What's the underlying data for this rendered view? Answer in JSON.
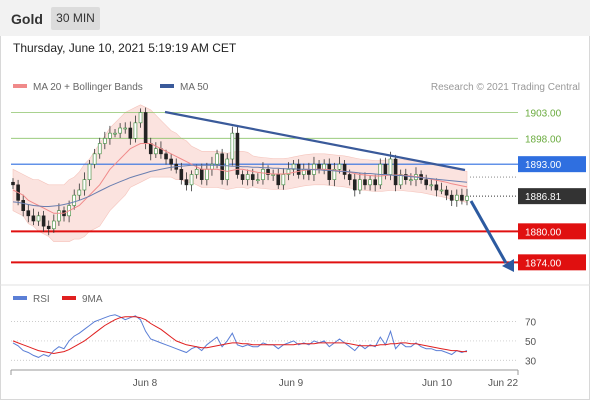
{
  "header": {
    "title": "Gold",
    "timeframe": "30 MIN"
  },
  "timestamp": "Thursday, June 10, 2021 5:19:19 AM CET",
  "legend_top": [
    {
      "label": "MA 20 + Bollinger Bands",
      "color": "#f08a8a"
    },
    {
      "label": "MA 50",
      "color": "#3a5a9a"
    }
  ],
  "credit": "Research © 2021 Trading Central",
  "legend_bottom": [
    {
      "label": "RSI",
      "color": "#5b7fd6"
    },
    {
      "label": "9MA",
      "color": "#e02020"
    }
  ],
  "colors": {
    "resistance": "#8cc36a",
    "pivot": "#2f6fe0",
    "support": "#e01010",
    "last": "#333333",
    "trendline": "#3a5a9a",
    "band": "#fbe3df"
  },
  "chart_data": [
    {
      "type": "candlestick",
      "title": "Gold",
      "x_labels": [
        "Jun 8",
        "Jun 9",
        "Jun 10",
        "Jun 22"
      ],
      "ylim": [
        1870.0,
        1906.0
      ],
      "levels": [
        {
          "label": "1903.00",
          "value": 1903.0,
          "kind": "resistance"
        },
        {
          "label": "1898.00",
          "value": 1898.0,
          "kind": "resistance"
        },
        {
          "label": "1893.00",
          "value": 1893.0,
          "kind": "pivot"
        },
        {
          "label": "1886.81",
          "value": 1886.81,
          "kind": "last"
        },
        {
          "label": "1880.00",
          "value": 1880.0,
          "kind": "support"
        },
        {
          "label": "1874.00",
          "value": 1874.0,
          "kind": "support"
        }
      ],
      "closes": [
        1889,
        1886,
        1884,
        1883,
        1882,
        1883,
        1881,
        1880.5,
        1882,
        1884,
        1883,
        1885,
        1887,
        1888,
        1890,
        1893,
        1895,
        1897,
        1898,
        1899,
        1899,
        1900,
        1900,
        1898,
        1901,
        1903,
        1897,
        1895,
        1896,
        1895,
        1894,
        1893,
        1892,
        1890,
        1889,
        1891,
        1892,
        1890,
        1892,
        1893,
        1895,
        1890,
        1894,
        1899,
        1891,
        1890,
        1891,
        1890,
        1890,
        1892,
        1891,
        1891,
        1889,
        1891,
        1892,
        1893,
        1891,
        1892,
        1891,
        1893,
        1892,
        1893,
        1890,
        1892,
        1893,
        1891,
        1890,
        1888,
        1890,
        1889,
        1890,
        1889,
        1893,
        1891,
        1894,
        1889,
        1891,
        1890,
        1890,
        1891,
        1890,
        1889,
        1889,
        1888,
        1888,
        1887,
        1886,
        1887,
        1886,
        1886.81
      ],
      "series": [
        {
          "name": "MA 20 + Bollinger Bands",
          "values": [
            1888,
            1887.5,
            1887,
            1886,
            1885.5,
            1885,
            1884.5,
            1884,
            1883.5,
            1883.5,
            1883.5,
            1884,
            1884.5,
            1885,
            1886,
            1887,
            1888,
            1889,
            1890.5,
            1892,
            1893,
            1894,
            1895,
            1896,
            1896.5,
            1897,
            1897,
            1897,
            1896.5,
            1896,
            1895.5,
            1895,
            1894.5,
            1894,
            1893.5,
            1893,
            1892.5,
            1892,
            1892,
            1892,
            1892,
            1891.8,
            1891.6,
            1891.8,
            1892,
            1892,
            1891.8,
            1891.6,
            1891.4,
            1891.3,
            1891.2,
            1891.1,
            1891.1,
            1891.1,
            1891.2,
            1891.4,
            1891.6,
            1891.8,
            1891.9,
            1892,
            1892,
            1892,
            1891.9,
            1891.8,
            1891.7,
            1891.6,
            1891.4,
            1891.2,
            1891,
            1890.9,
            1890.8,
            1890.7,
            1890.7,
            1890.8,
            1890.9,
            1890.9,
            1890.9,
            1890.8,
            1890.7,
            1890.6,
            1890.5,
            1890.3,
            1890.1,
            1889.9,
            1889.7,
            1889.5,
            1889.2,
            1889,
            1888.8,
            1888.6
          ]
        },
        {
          "name": "MA 50",
          "values": [
            1885.7,
            1885.6,
            1885.4,
            1885.2,
            1885,
            1884.9,
            1884.8,
            1884.8,
            1884.9,
            1885,
            1885.2,
            1885.4,
            1885.7,
            1886,
            1886.4,
            1886.8,
            1887.3,
            1887.8,
            1888.3,
            1888.8,
            1889.2,
            1889.6,
            1890,
            1890.4,
            1890.7,
            1891,
            1891.3,
            1891.6,
            1891.8,
            1892,
            1892.2,
            1892.4,
            1892.5,
            1892.6,
            1892.7,
            1892.8,
            1892.8,
            1892.8,
            1892.8,
            1892.8,
            1892.8,
            1892.7,
            1892.7,
            1892.6,
            1892.6,
            1892.5,
            1892.5,
            1892.4,
            1892.4,
            1892.3,
            1892.3,
            1892.2,
            1892.2,
            1892.1,
            1892.1,
            1892.1,
            1892,
            1892,
            1892,
            1891.9,
            1891.9,
            1891.8,
            1891.8,
            1891.7,
            1891.6,
            1891.6,
            1891.5,
            1891.4,
            1891.3,
            1891.2,
            1891.2,
            1891.1,
            1891,
            1891,
            1890.9,
            1890.8,
            1890.8,
            1890.7,
            1890.6,
            1890.5,
            1890.4,
            1890.3,
            1890.2,
            1890.1,
            1890,
            1889.9,
            1889.8,
            1889.7,
            1889.6,
            1889.5
          ]
        }
      ],
      "bands_width": [
        4,
        4,
        4,
        4.5,
        4.5,
        5,
        5,
        5,
        5.5,
        5.5,
        5.5,
        6,
        6,
        6.5,
        7,
        7,
        7.5,
        8,
        8,
        8,
        8,
        8,
        8,
        7.5,
        7.5,
        7.5,
        7,
        6.5,
        6,
        5.5,
        5,
        4.5,
        4.5,
        4,
        4,
        3.5,
        3.5,
        3.5,
        3.5,
        3.5,
        3.5,
        3.5,
        3.5,
        3.5,
        3.5,
        3.5,
        3.5,
        3,
        3,
        3,
        3,
        3,
        3,
        3,
        3,
        3,
        3,
        3,
        3,
        3,
        3,
        3,
        3,
        3,
        3,
        3,
        3,
        3,
        3,
        3,
        3,
        3,
        3,
        3,
        3,
        3,
        3,
        3,
        3,
        3,
        3,
        3,
        3,
        3,
        3,
        3,
        3,
        3,
        3,
        3
      ]
    },
    {
      "type": "line",
      "title": "",
      "yticks": [
        70,
        50,
        30
      ],
      "ylim": [
        22,
        82
      ],
      "series": [
        {
          "name": "RSI",
          "values": [
            48,
            45,
            40,
            38,
            35,
            33,
            36,
            34,
            40,
            44,
            42,
            50,
            55,
            58,
            62,
            66,
            70,
            72,
            74,
            76,
            77,
            75,
            72,
            74,
            76,
            72,
            60,
            52,
            50,
            48,
            46,
            44,
            42,
            40,
            38,
            42,
            44,
            40,
            46,
            50,
            54,
            44,
            50,
            58,
            46,
            44,
            46,
            44,
            44,
            48,
            46,
            46,
            42,
            46,
            48,
            50,
            46,
            48,
            46,
            50,
            48,
            50,
            44,
            48,
            52,
            48,
            44,
            40,
            46,
            42,
            46,
            44,
            54,
            46,
            60,
            42,
            48,
            44,
            44,
            48,
            44,
            42,
            42,
            40,
            40,
            38,
            36,
            40,
            38,
            40
          ]
        },
        {
          "name": "9MA",
          "values": [
            50,
            48,
            46,
            44,
            42,
            40,
            39,
            38,
            37,
            38,
            39,
            41,
            44,
            47,
            50,
            54,
            58,
            62,
            66,
            69,
            72,
            74,
            75,
            75,
            75,
            74,
            72,
            68,
            65,
            62,
            58,
            54,
            50,
            48,
            46,
            45,
            44,
            43,
            43,
            44,
            45,
            46,
            47,
            48,
            48,
            47,
            47,
            46,
            46,
            46,
            46,
            46,
            46,
            46,
            46,
            46,
            47,
            47,
            47,
            47,
            48,
            48,
            48,
            48,
            48,
            48,
            47,
            46,
            45,
            45,
            45,
            45,
            46,
            46,
            47,
            47,
            48,
            48,
            47,
            47,
            46,
            45,
            44,
            43,
            42,
            41,
            40,
            40,
            39,
            39
          ]
        }
      ]
    }
  ]
}
